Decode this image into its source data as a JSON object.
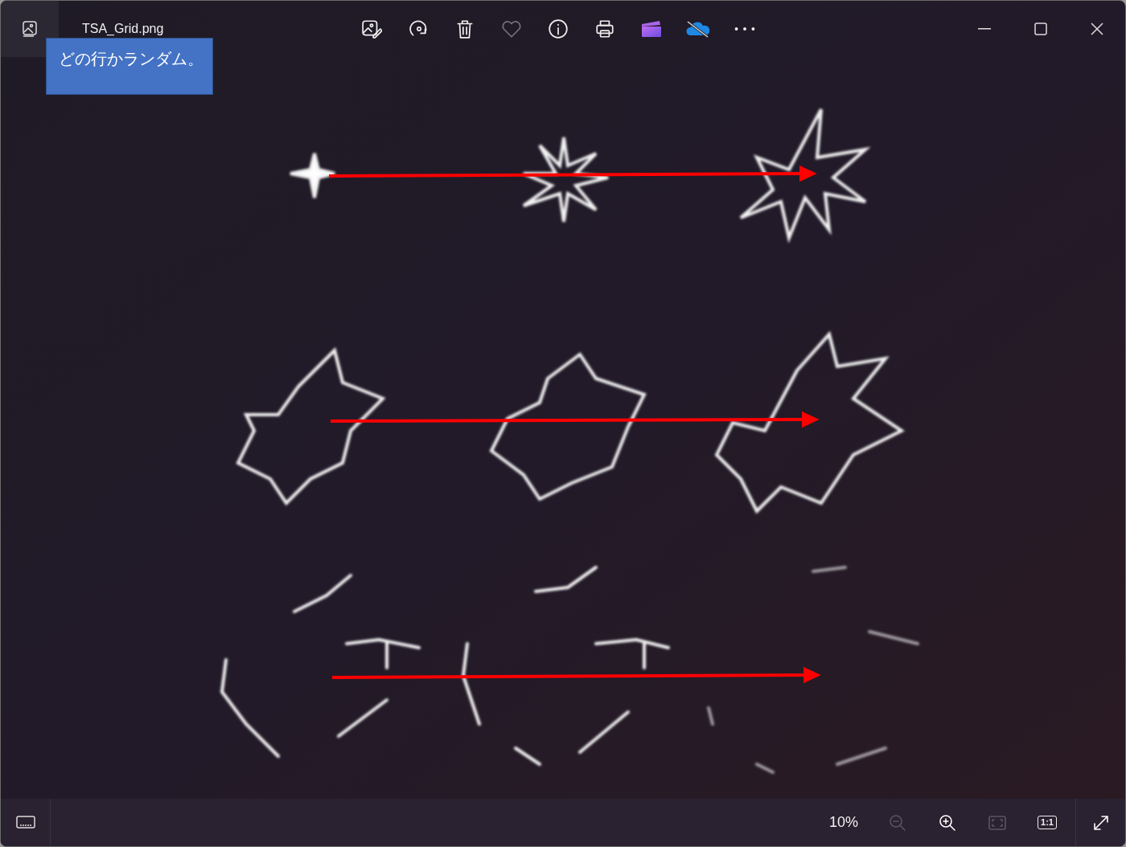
{
  "window": {
    "title": "TSA_Grid.png"
  },
  "callout": {
    "text": "どの行かランダム。"
  },
  "toolbar": [
    {
      "kind": "edit"
    },
    {
      "kind": "rotate"
    },
    {
      "kind": "delete"
    },
    {
      "kind": "favorite"
    },
    {
      "kind": "info"
    },
    {
      "kind": "print"
    },
    {
      "kind": "video"
    },
    {
      "kind": "cloud"
    },
    {
      "kind": "more"
    }
  ],
  "bottom_bar": {
    "zoom": "10%",
    "actual_size_label": "1:1",
    "controls": [
      {
        "kind": "zoom_out",
        "disabled": true
      },
      {
        "kind": "zoom_in",
        "disabled": false
      },
      {
        "kind": "fit",
        "disabled": true
      },
      {
        "kind": "actual_size",
        "disabled": false
      },
      {
        "kind": "fullscreen",
        "disabled": false
      }
    ]
  }
}
